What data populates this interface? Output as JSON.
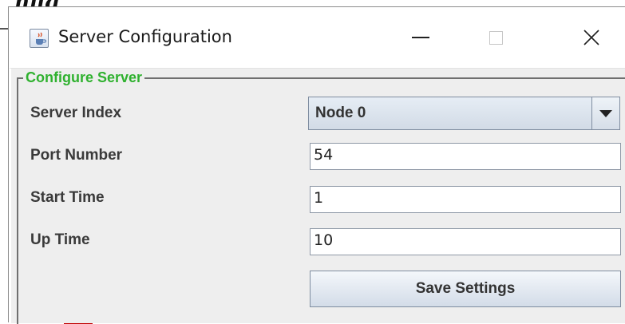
{
  "backdrop": {
    "partial_heading": "nfig"
  },
  "window": {
    "title": "Server Configuration",
    "icon": "java-cup-icon",
    "controls": {
      "minimize": "minimize-icon",
      "maximize": "maximize-icon",
      "close": "close-icon",
      "close_glyph": "✕"
    }
  },
  "form": {
    "group_title": "Configure Server",
    "fields": [
      {
        "label": "Server Index",
        "type": "select",
        "value": "Node 0"
      },
      {
        "label": "Port Number",
        "type": "text",
        "value": "54"
      },
      {
        "label": "Start Time",
        "type": "text",
        "value": "1"
      },
      {
        "label": "Up Time",
        "type": "text",
        "value": "10"
      }
    ],
    "save_label": "Save Settings"
  },
  "colors": {
    "legend": "#2fb12f",
    "client_bg": "#eeeeee",
    "backdrop_accent": "#c00000"
  }
}
